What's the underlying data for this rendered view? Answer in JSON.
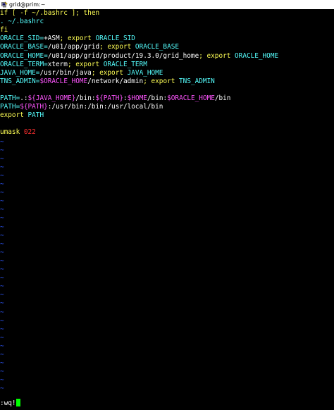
{
  "window": {
    "title": "grid@prim:~",
    "icon": "putty-terminal-icon"
  },
  "colors": {
    "background": "#000000",
    "tilde": "#2f58ff",
    "yellow": "#ffff55",
    "cyan": "#55ffff",
    "green": "#55ff55",
    "magenta": "#ff55ff",
    "red": "#ff3030",
    "cursor": "#00ff00"
  },
  "editor": {
    "file_lines": [
      [
        {
          "t": "if [ -f ~/.bashrc ]; then",
          "c": "yellow"
        }
      ],
      [
        {
          "t": ". ~/.bashrc",
          "c": "cyan"
        }
      ],
      [
        {
          "t": "fi",
          "c": "yellow"
        }
      ],
      [
        {
          "t": "ORACLE_SID=",
          "c": "cyan"
        },
        {
          "t": "+ASM",
          "c": "white"
        },
        {
          "t": "; export ",
          "c": "yellow"
        },
        {
          "t": "ORACLE_SID",
          "c": "cyan"
        }
      ],
      [
        {
          "t": "ORACLE_BASE=",
          "c": "cyan"
        },
        {
          "t": "/u01/app/grid",
          "c": "white"
        },
        {
          "t": "; export ",
          "c": "yellow"
        },
        {
          "t": "ORACLE_BASE",
          "c": "cyan"
        }
      ],
      [
        {
          "t": "ORACLE_HOME=",
          "c": "cyan"
        },
        {
          "t": "/u01/app/grid/product/19.3.0/grid_home",
          "c": "white"
        },
        {
          "t": "; export ",
          "c": "yellow"
        },
        {
          "t": "ORACLE_HOME",
          "c": "cyan"
        }
      ],
      [
        {
          "t": "ORACLE_TERM=",
          "c": "cyan"
        },
        {
          "t": "xterm",
          "c": "white"
        },
        {
          "t": "; export ",
          "c": "yellow"
        },
        {
          "t": "ORACLE_TERM",
          "c": "cyan"
        }
      ],
      [
        {
          "t": "JAVA_HOME=",
          "c": "cyan"
        },
        {
          "t": "/usr/bin/java",
          "c": "white"
        },
        {
          "t": "; export ",
          "c": "yellow"
        },
        {
          "t": "JAVA_HOME",
          "c": "cyan"
        }
      ],
      [
        {
          "t": "TNS_ADMIN=",
          "c": "cyan"
        },
        {
          "t": "$ORACLE_HOME",
          "c": "magenta"
        },
        {
          "t": "/network/admin",
          "c": "white"
        },
        {
          "t": "; export ",
          "c": "yellow"
        },
        {
          "t": "TNS_ADMIN",
          "c": "cyan"
        }
      ],
      [],
      [
        {
          "t": "PATH=",
          "c": "cyan"
        },
        {
          "t": ".:",
          "c": "white"
        },
        {
          "t": "${JAVA_HOME}",
          "c": "magenta"
        },
        {
          "t": "/bin:",
          "c": "white"
        },
        {
          "t": "${PATH}",
          "c": "magenta"
        },
        {
          "t": ":",
          "c": "white"
        },
        {
          "t": "$HOME",
          "c": "magenta"
        },
        {
          "t": "/bin:",
          "c": "white"
        },
        {
          "t": "$ORACLE_HOME",
          "c": "magenta"
        },
        {
          "t": "/bin",
          "c": "white"
        }
      ],
      [
        {
          "t": "PATH=",
          "c": "cyan"
        },
        {
          "t": "${PATH}",
          "c": "magenta"
        },
        {
          "t": ":/usr/bin:/bin:/usr/local/bin",
          "c": "white"
        }
      ],
      [
        {
          "t": "export ",
          "c": "yellow"
        },
        {
          "t": "PATH",
          "c": "cyan"
        }
      ],
      [],
      [
        {
          "t": "umask ",
          "c": "yellow"
        },
        {
          "t": "022",
          "c": "red"
        }
      ]
    ],
    "tilde_char": "~",
    "tilde_count": 30,
    "command_line": ":wq!"
  }
}
